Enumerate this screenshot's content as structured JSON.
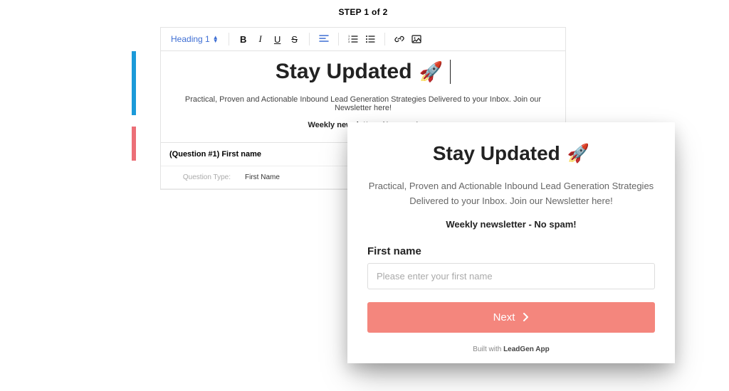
{
  "editor": {
    "step_label": "STEP 1 of 2",
    "heading_dropdown": "Heading 1",
    "title": "Stay Updated",
    "rocket": "🚀",
    "desc": "Practical, Proven and Actionable Inbound Lead Generation Strategies Delivered to your Inbox. Join our Newsletter here!",
    "desc2": "Weekly newsletter - No spam!",
    "question_title": "(Question #1) First name",
    "question_type_label": "Question Type:",
    "question_type_value": "First Name"
  },
  "preview": {
    "title": "Stay Updated",
    "rocket": "🚀",
    "desc": "Practical, Proven and Actionable Inbound Lead Generation Strategies Delivered to your Inbox. Join our Newsletter here!",
    "desc2": "Weekly newsletter - No spam!",
    "field_label": "First name",
    "placeholder": "Please enter your first name",
    "next_label": "Next",
    "footer_prefix": "Built with ",
    "footer_brand": "LeadGen App"
  }
}
